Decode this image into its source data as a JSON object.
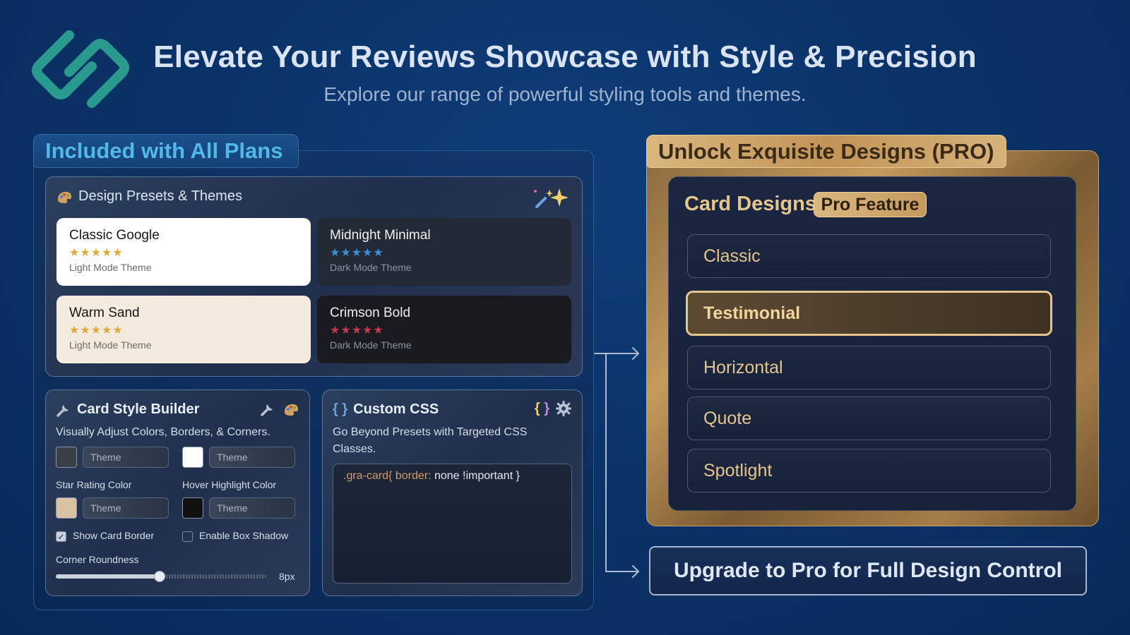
{
  "header": {
    "title": "Elevate Your Reviews Showcase with Style & Precision",
    "subtitle": "Explore our range of powerful styling tools and themes."
  },
  "left_panel": {
    "tab_label": "Included with All Plans",
    "presets": {
      "title": "Design Presets & Themes",
      "items": [
        {
          "name": "Classic Google",
          "mode": "Light Mode Theme",
          "rating": 5,
          "star_color": "#e0a93c"
        },
        {
          "name": "Midnight Minimal",
          "mode": "Dark Mode Theme",
          "rating": 5,
          "star_color": "#3a8fd6"
        },
        {
          "name": "Warm Sand",
          "mode": "Light Mode Theme",
          "rating": 5,
          "star_color": "#e0a93c"
        },
        {
          "name": "Crimson Bold",
          "mode": "Dark Mode Theme",
          "rating": 5,
          "star_color": "#c6384e"
        }
      ]
    },
    "builder": {
      "title": "Card Style Builder",
      "description": "Visually Adjust Colors, Borders, & Corners.",
      "fields": [
        {
          "value": "Theme",
          "swatch": "#3a3f48"
        },
        {
          "value": "Theme",
          "swatch": "#ffffff"
        },
        {
          "value": "Theme",
          "swatch": "#d9c2a3"
        },
        {
          "value": "Theme",
          "swatch": "#111111"
        }
      ],
      "star_rating_label": "Star Rating Color",
      "hover_label": "Hover Highlight Color",
      "show_border_label": "Show Card Border",
      "show_border_checked": true,
      "box_shadow_label": "Enable Box Shadow",
      "box_shadow_checked": false,
      "corner_label": "Corner Roundness",
      "corner_value": "8px",
      "corner_fraction": 0.49
    },
    "custom_css": {
      "title": "Custom CSS",
      "description": "Go Beyond Presets with Targeted CSS Classes.",
      "code_selector": ".gra-card{ border:",
      "code_value": " none !important }"
    }
  },
  "pro_panel": {
    "tab_label": "Unlock Exquisite Designs (PRO)",
    "section_title": "Card Designs",
    "badge": "Pro Feature",
    "designs": [
      "Classic",
      "Testimonial",
      "Horizontal",
      "Quote",
      "Spotlight"
    ],
    "active_design": "Testimonial",
    "upgrade_label": "Upgrade to Pro for Full Design Control"
  },
  "colors": {
    "accent_gold": "#e6c48e",
    "accent_blue": "#52b8ea",
    "logo_teal": "#2a9a8f"
  }
}
